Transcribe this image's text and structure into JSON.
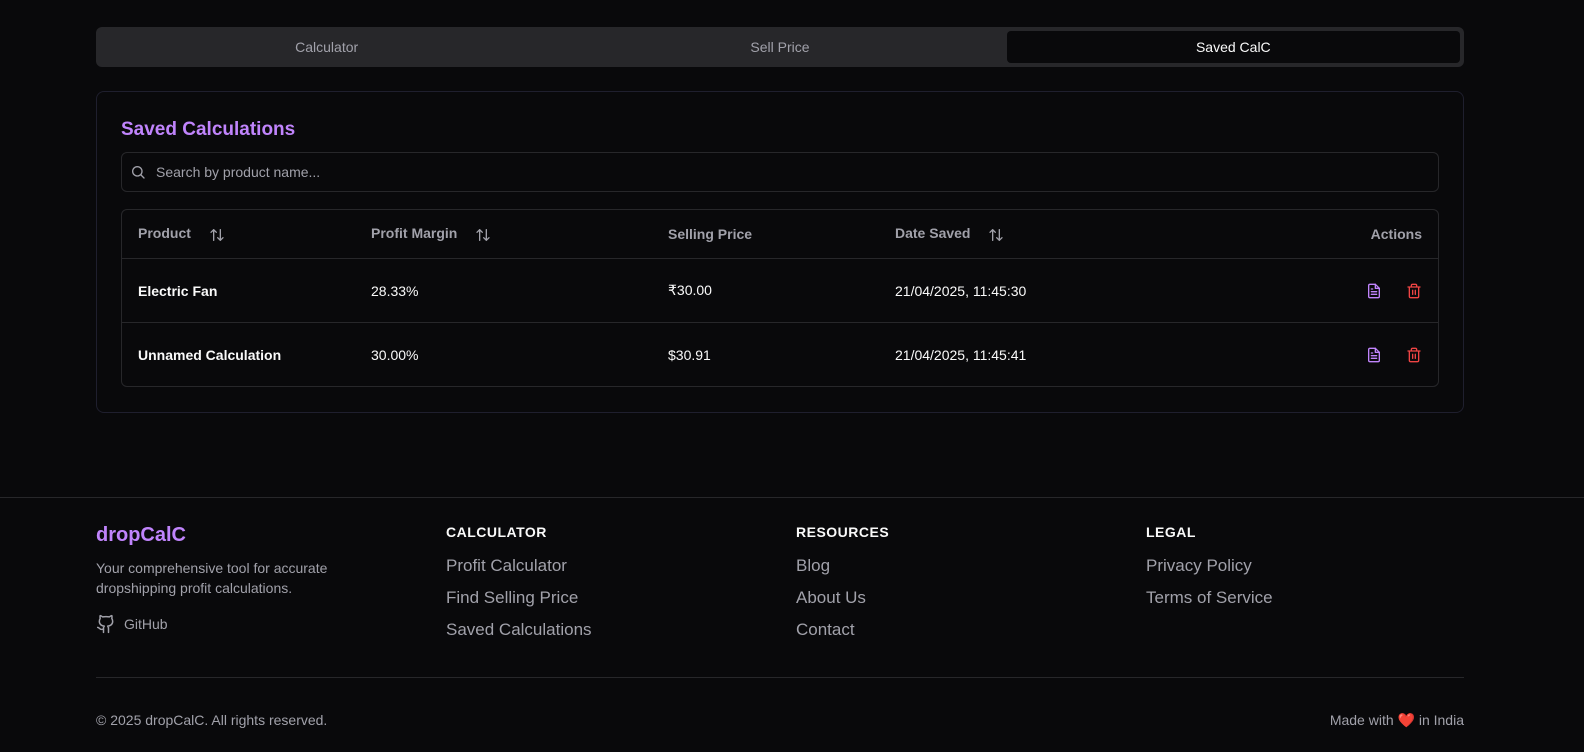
{
  "tabs": [
    {
      "label": "Calculator"
    },
    {
      "label": "Sell Price"
    },
    {
      "label": "Saved CalC"
    }
  ],
  "card": {
    "title": "Saved Calculations",
    "search_placeholder": "Search by product name..."
  },
  "table": {
    "headers": {
      "product": "Product",
      "margin": "Profit Margin",
      "price": "Selling Price",
      "date": "Date Saved",
      "actions": "Actions"
    },
    "rows": [
      {
        "product": "Electric Fan",
        "margin": "28.33%",
        "price": "₹30.00",
        "date": "21/04/2025, 11:45:30"
      },
      {
        "product": "Unnamed Calculation",
        "margin": "30.00%",
        "price": "$30.91",
        "date": "21/04/2025, 11:45:41"
      }
    ]
  },
  "footer": {
    "brand": "dropCalC",
    "tagline": "Your comprehensive tool for accurate dropshipping profit calculations.",
    "github": "GitHub",
    "columns": [
      {
        "title": "CALCULATOR",
        "links": [
          "Profit Calculator",
          "Find Selling Price",
          "Saved Calculations"
        ]
      },
      {
        "title": "RESOURCES",
        "links": [
          "Blog",
          "About Us",
          "Contact"
        ]
      },
      {
        "title": "LEGAL",
        "links": [
          "Privacy Policy",
          "Terms of Service"
        ]
      }
    ],
    "copyright": "© 2025 dropCalC. All rights reserved.",
    "made_prefix": "Made with",
    "heart": "❤️",
    "made_suffix": "in India"
  },
  "colors": {
    "accent": "#c084fc",
    "danger": "#ef4444",
    "background": "#09090b"
  }
}
